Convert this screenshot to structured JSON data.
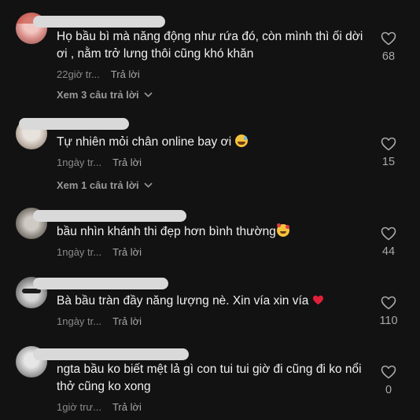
{
  "comments": [
    {
      "text": "Họ bầu bì mà năng động như rứa đó, còn mình thì ối dời ơi , nằm trở lưng thôi cũng khó khăn",
      "time": "22giờ tr...",
      "reply_label": "Trả lời",
      "likes": "68",
      "view_replies": "Xem 3 câu trả lời"
    },
    {
      "text": "Tự nhiên mỏi chân online bay ơi",
      "emoji": "grinning-sweat-emoji",
      "time": "1ngày tr...",
      "reply_label": "Trả lời",
      "likes": "15",
      "view_replies": "Xem 1 câu trả lời"
    },
    {
      "text": "bầu nhìn khánh thi đẹp hơn bình thường",
      "emoji": "smiling-hearts-emoji",
      "time": "1ngày tr...",
      "reply_label": "Trả lời",
      "likes": "44"
    },
    {
      "text": "Bà bầu tràn đầy năng lượng nè. Xin vía xin vía",
      "emoji": "red-heart-emoji",
      "time": "1ngày tr...",
      "reply_label": "Trả lời",
      "likes": "110"
    },
    {
      "text": "ngta bầu ko biết mệt lả gì con tui tui giờ đi cũng đi ko nổi thở cũng ko xong",
      "time": "1giờ trư...",
      "reply_label": "Trả lời",
      "likes": "0"
    }
  ],
  "colors": {
    "background": "#121212",
    "text": "#f0f0f0",
    "meta": "#8a8a8a",
    "redaction": "#d9d9d9",
    "heart_emoji": "#e0203a"
  }
}
